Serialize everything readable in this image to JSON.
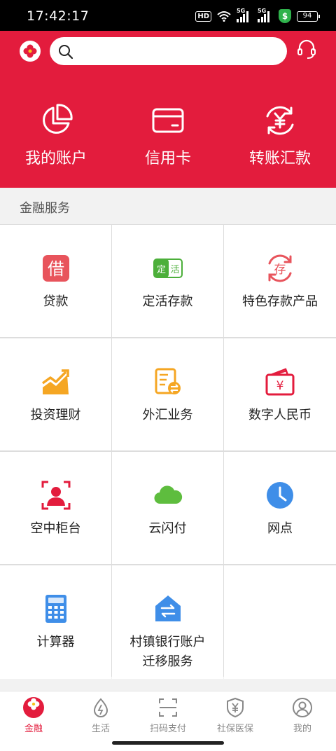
{
  "status": {
    "time": "17:42:17",
    "hd": "HD",
    "net1": "5G",
    "net2": "5G",
    "shield": "$",
    "battery": "94"
  },
  "header": {
    "search_placeholder": "",
    "quick": [
      {
        "label": "我的账户",
        "icon": "pie-chart-icon"
      },
      {
        "label": "信用卡",
        "icon": "credit-card-icon"
      },
      {
        "label": "转账汇款",
        "icon": "yuan-refresh-icon"
      }
    ]
  },
  "section": {
    "title": "金融服务"
  },
  "services": [
    {
      "label": "贷款",
      "icon": "loan-icon",
      "icon_text": "借",
      "color": "#e8545c"
    },
    {
      "label": "定活存款",
      "icon": "deposit-icon",
      "icon_text_left": "定",
      "icon_text_right": "活",
      "color": "#4caf3a"
    },
    {
      "label": "特色存款产品",
      "icon": "special-deposit-icon",
      "icon_text": "存",
      "color": "#e8545c"
    },
    {
      "label": "投资理财",
      "icon": "investment-chart-icon",
      "color": "#f5a623"
    },
    {
      "label": "外汇业务",
      "icon": "forex-icon",
      "color": "#f5a623"
    },
    {
      "label": "数字人民币",
      "icon": "digital-rmb-wallet-icon",
      "icon_text": "¥",
      "color": "#e31c3d"
    },
    {
      "label": "空中柜台",
      "icon": "remote-counter-icon",
      "color": "#e31c3d"
    },
    {
      "label": "云闪付",
      "icon": "cloud-icon",
      "color": "#5ebd3e"
    },
    {
      "label": "网点",
      "icon": "clock-icon",
      "color": "#3f8ee8"
    },
    {
      "label": "计算器",
      "icon": "calculator-icon",
      "color": "#3f8ee8"
    },
    {
      "label": "村镇银行账户\n迁移服务",
      "icon": "account-transfer-icon",
      "color": "#3f8ee8"
    }
  ],
  "tabs": [
    {
      "label": "金融",
      "icon": "finance-logo-icon",
      "active": true
    },
    {
      "label": "生活",
      "icon": "life-drop-icon",
      "active": false
    },
    {
      "label": "扫码支付",
      "icon": "scan-icon",
      "active": false
    },
    {
      "label": "社保医保",
      "icon": "insurance-shield-icon",
      "active": false
    },
    {
      "label": "我的",
      "icon": "profile-icon",
      "active": false
    }
  ],
  "colors": {
    "brand": "#e31c3d",
    "active_tab": "#e31c3d"
  }
}
